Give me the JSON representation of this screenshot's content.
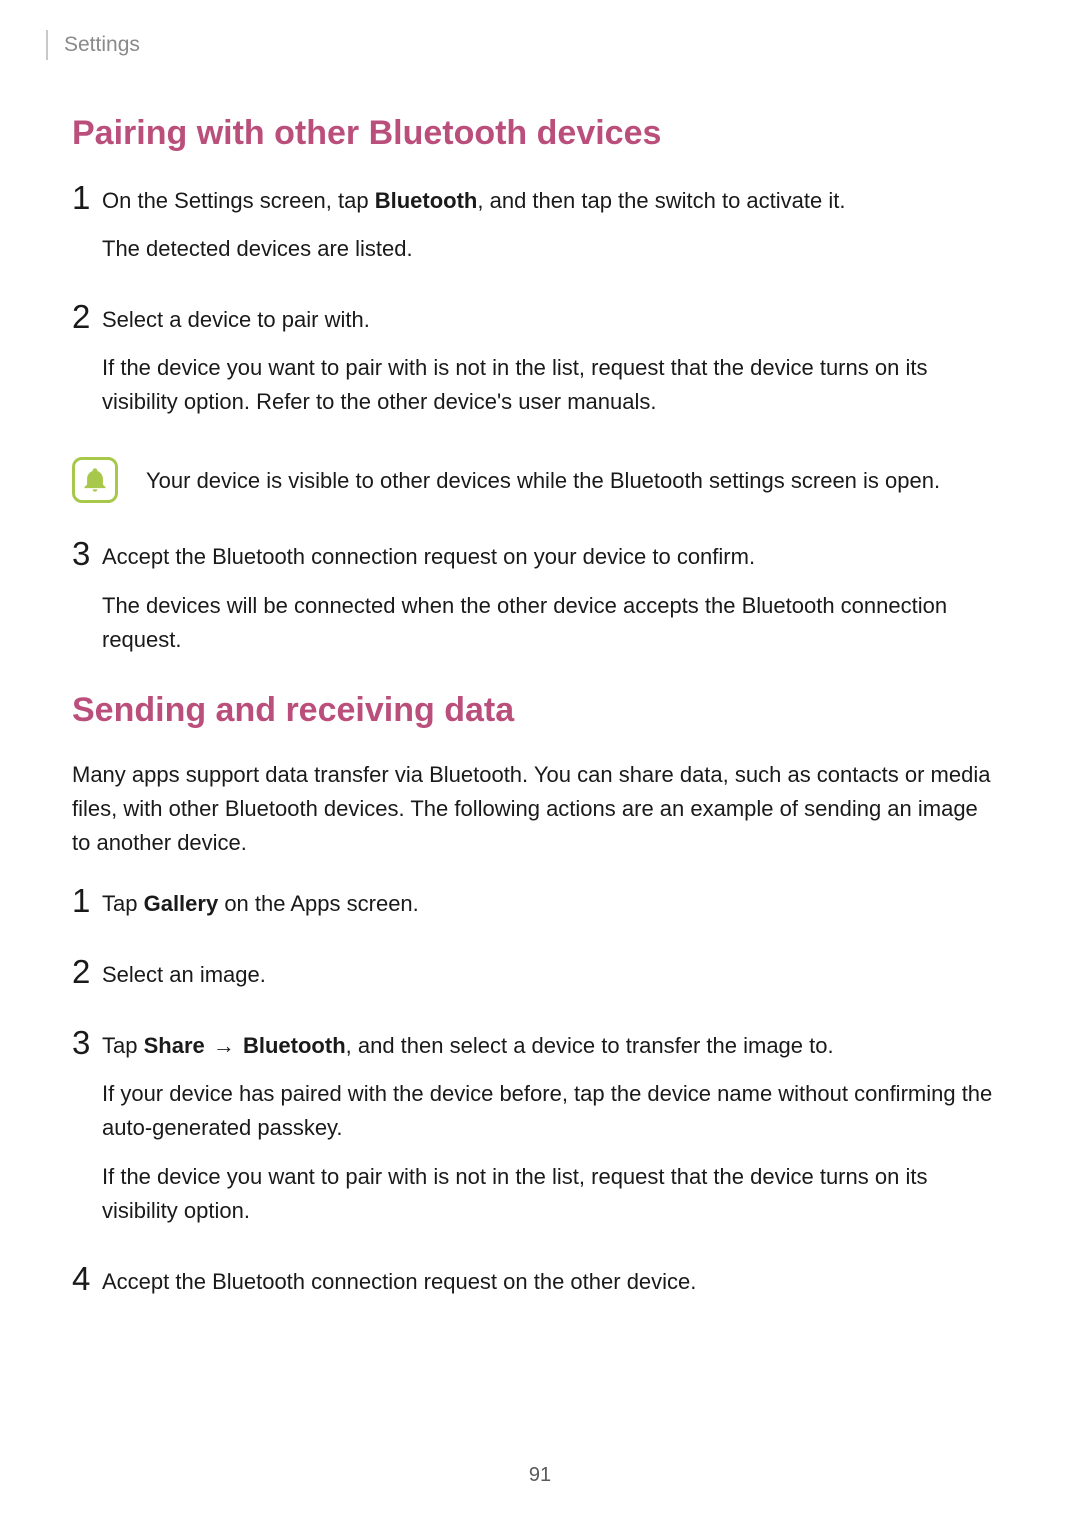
{
  "header": {
    "crumb": "Settings"
  },
  "section1": {
    "title": "Pairing with other Bluetooth devices",
    "steps": [
      {
        "num": "1",
        "line1_pre": "On the Settings screen, tap ",
        "line1_bold": "Bluetooth",
        "line1_post": ", and then tap the switch to activate it.",
        "line2": "The detected devices are listed."
      },
      {
        "num": "2",
        "line1": "Select a device to pair with.",
        "line2": "If the device you want to pair with is not in the list, request that the device turns on its visibility option. Refer to the other device's user manuals."
      },
      {
        "num": "3",
        "line1": "Accept the Bluetooth connection request on your device to confirm.",
        "line2": "The devices will be connected when the other device accepts the Bluetooth connection request."
      }
    ],
    "note": "Your device is visible to other devices while the Bluetooth settings screen is open."
  },
  "section2": {
    "title": "Sending and receiving data",
    "intro": "Many apps support data transfer via Bluetooth. You can share data, such as contacts or media files, with other Bluetooth devices. The following actions are an example of sending an image to another device.",
    "steps": [
      {
        "num": "1",
        "line1_pre": "Tap ",
        "line1_bold": "Gallery",
        "line1_post": " on the Apps screen."
      },
      {
        "num": "2",
        "line1": "Select an image."
      },
      {
        "num": "3",
        "line1_pre": "Tap ",
        "line1_bold1": "Share",
        "line1_arrow": " → ",
        "line1_bold2": "Bluetooth",
        "line1_post": ", and then select a device to transfer the image to.",
        "line2": "If your device has paired with the device before, tap the device name without confirming the auto-generated passkey.",
        "line3": "If the device you want to pair with is not in the list, request that the device turns on its visibility option."
      },
      {
        "num": "4",
        "line1": "Accept the Bluetooth connection request on the other device."
      }
    ]
  },
  "page_number": "91"
}
